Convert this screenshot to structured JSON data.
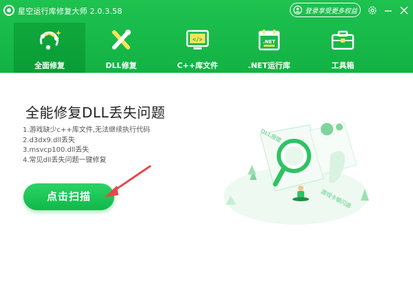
{
  "app": {
    "title": "星空运行库修复大师 2.0.3.58",
    "login_text": "登录享受更多权益"
  },
  "nav": {
    "tabs": [
      {
        "label": "全面修复",
        "icon": "repair-icon",
        "active": true
      },
      {
        "label": "DLL修复",
        "icon": "tools-icon",
        "active": false
      },
      {
        "label": "C++库文件",
        "icon": "code-monitor-icon",
        "active": false
      },
      {
        "label": ".NET运行库",
        "icon": "net-calendar-icon",
        "active": false
      },
      {
        "label": "工具箱",
        "icon": "toolbox-icon",
        "active": false
      }
    ]
  },
  "main": {
    "title": "全能修复DLL丢失问题",
    "issues": [
      "1.游戏缺少c++库文件,无法继续执行代码",
      "2.d3dx9.dll丢失",
      "3.msvcp100.dll丢失",
      "4.常见dll丢失问题一键修复"
    ],
    "scan_button": "点击扫描"
  },
  "illustration": {
    "dll_tag": "DLL报错",
    "game_tag": "游戏卡顿闪退"
  },
  "colors": {
    "brand_green": "#15b648",
    "active_tab": "#0a9d35",
    "scan_button": "#16bd4f",
    "arrow": "#e8474a"
  }
}
